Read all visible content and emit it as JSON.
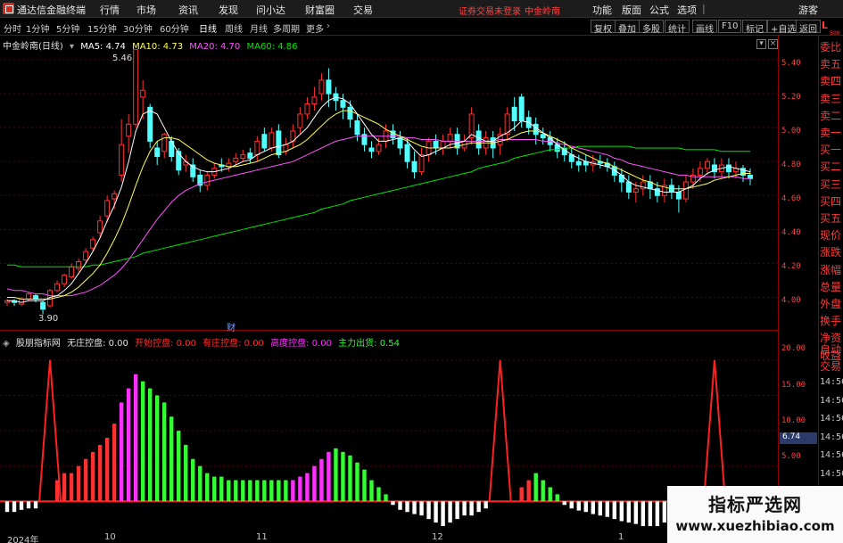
{
  "app": {
    "title": "通达信金融终端",
    "menus": [
      "行情",
      "市场",
      "资讯",
      "发现",
      "问小达",
      "财富圈",
      "交易"
    ],
    "notice": "证券交易未登录",
    "stock_name_top": "中金岭南",
    "right_menus": [
      "功能",
      "版面",
      "公式",
      "选项"
    ],
    "guest": "游客"
  },
  "toolbar": {
    "periods": [
      "分时",
      "1分钟",
      "5分钟",
      "15分钟",
      "30分钟",
      "60分钟",
      "日线",
      "周线",
      "月线",
      "多周期",
      "更多"
    ],
    "active_period": "日线",
    "right_buttons": [
      "复权",
      "叠加",
      "多股",
      "统计",
      "画线",
      "F10",
      "标记",
      "+自选",
      "返回"
    ],
    "L_label": "L",
    "L_sub": "500"
  },
  "main_legend": {
    "stock": "中金岭南(日线)",
    "ma5": "MA5: 4.74",
    "ma10": "MA10: 4.73",
    "ma20": "MA20: 4.70",
    "ma60": "MA60: 4.86"
  },
  "price_axis": [
    "5.40",
    "5.20",
    "5.00",
    "4.80",
    "4.60",
    "4.40",
    "4.20",
    "4.00"
  ],
  "annotations": {
    "high": "5.46",
    "low": "3.90",
    "cai": "财"
  },
  "sub_legend": {
    "name": "股朋指标网",
    "none": "无庄控盘: 0.00",
    "start": "开始控盘: 0.00",
    "has": "有庄控盘: 0.00",
    "high": "高度控盘: 0.00",
    "out": "主力出货: 0.54"
  },
  "sub_axis": [
    "20.00",
    "15.00",
    "10.00",
    "5.00"
  ],
  "sub_value_badge": "6.74",
  "side_panel": [
    "委比",
    "卖五",
    "卖四",
    "卖三",
    "卖二",
    "卖一",
    "买一",
    "买二",
    "买三",
    "买四",
    "买五",
    "现价",
    "涨跌",
    "涨幅",
    "总量",
    "外盘",
    "换手",
    "净资",
    "收益"
  ],
  "side_panel2": [
    "自动",
    "交易"
  ],
  "side_times": [
    "14:56",
    "14:56",
    "14:56",
    "14:56",
    "14:56",
    "14:56",
    "14:56",
    "14:56"
  ],
  "dates": [
    "2024年",
    "10",
    "11",
    "12",
    "1"
  ],
  "watermark": {
    "title": "指标严选网",
    "url": "www.xuezhibiao.com"
  },
  "colors": {
    "up": "#ff3232",
    "down": "#54ffff",
    "ma5": "#ffffff",
    "ma10": "#ffff54",
    "ma20": "#ff54ff",
    "ma60": "#00e600",
    "start_col": "#ff3030",
    "has_col": "#ff30ff",
    "high_col": "#ff30ff",
    "out_col": "#30ff30"
  },
  "chart_data": {
    "type": "candlestick",
    "ylim": [
      3.85,
      5.5
    ],
    "candles": [
      [
        3.97,
        3.98,
        3.95,
        3.99
      ],
      [
        3.98,
        3.97,
        3.95,
        3.99
      ],
      [
        3.96,
        3.99,
        3.95,
        4.0
      ],
      [
        3.99,
        4.02,
        3.98,
        4.03
      ],
      [
        4.01,
        3.99,
        3.97,
        4.02
      ],
      [
        3.97,
        3.93,
        3.9,
        3.98
      ],
      [
        3.95,
        4.04,
        3.94,
        4.05
      ],
      [
        4.04,
        4.08,
        4.03,
        4.1
      ],
      [
        4.08,
        4.13,
        4.06,
        4.14
      ],
      [
        4.12,
        4.18,
        4.11,
        4.2
      ],
      [
        4.17,
        4.21,
        4.15,
        4.23
      ],
      [
        4.22,
        4.27,
        4.2,
        4.29
      ],
      [
        4.29,
        4.34,
        4.27,
        4.36
      ],
      [
        4.38,
        4.45,
        4.35,
        4.48
      ],
      [
        4.48,
        4.57,
        4.44,
        4.6
      ],
      [
        4.58,
        4.61,
        4.52,
        4.63
      ],
      [
        4.72,
        4.9,
        4.68,
        5.05
      ],
      [
        4.95,
        5.02,
        4.85,
        5.08
      ],
      [
        5.02,
        5.46,
        5.0,
        5.46
      ],
      [
        5.18,
        5.22,
        5.05,
        5.28
      ],
      [
        5.12,
        4.92,
        4.88,
        5.14
      ],
      [
        4.88,
        4.83,
        4.78,
        4.92
      ],
      [
        4.86,
        4.96,
        4.82,
        4.97
      ],
      [
        4.92,
        4.83,
        4.8,
        4.95
      ],
      [
        4.86,
        4.75,
        4.72,
        4.88
      ],
      [
        4.78,
        4.8,
        4.74,
        4.84
      ],
      [
        4.78,
        4.71,
        4.68,
        4.82
      ],
      [
        4.72,
        4.66,
        4.62,
        4.75
      ],
      [
        4.66,
        4.72,
        4.63,
        4.74
      ],
      [
        4.72,
        4.76,
        4.7,
        4.79
      ],
      [
        4.78,
        4.77,
        4.74,
        4.82
      ],
      [
        4.77,
        4.79,
        4.74,
        4.82
      ],
      [
        4.8,
        4.82,
        4.78,
        4.85
      ],
      [
        4.82,
        4.84,
        4.8,
        4.87
      ],
      [
        4.85,
        4.82,
        4.79,
        4.88
      ],
      [
        4.84,
        4.92,
        4.8,
        4.95
      ],
      [
        4.96,
        4.88,
        4.86,
        5.0
      ],
      [
        4.88,
        4.97,
        4.86,
        5.0
      ],
      [
        4.98,
        4.84,
        4.82,
        5.02
      ],
      [
        4.86,
        4.9,
        4.84,
        4.94
      ],
      [
        4.92,
        4.98,
        4.88,
        5.02
      ],
      [
        5.0,
        5.08,
        4.96,
        5.12
      ],
      [
        5.08,
        5.14,
        5.05,
        5.18
      ],
      [
        5.14,
        5.18,
        5.1,
        5.24
      ],
      [
        5.2,
        5.28,
        5.16,
        5.32
      ],
      [
        5.28,
        5.2,
        5.12,
        5.35
      ],
      [
        5.2,
        5.16,
        5.1,
        5.24
      ],
      [
        5.16,
        5.12,
        5.05,
        5.2
      ],
      [
        5.12,
        5.05,
        5.0,
        5.16
      ],
      [
        5.04,
        4.96,
        4.92,
        5.08
      ],
      [
        4.96,
        4.9,
        4.86,
        5.0
      ],
      [
        4.88,
        4.86,
        4.82,
        4.92
      ],
      [
        4.86,
        4.9,
        4.84,
        4.94
      ],
      [
        4.92,
        4.98,
        4.88,
        5.02
      ],
      [
        4.98,
        4.94,
        4.9,
        5.02
      ],
      [
        4.94,
        4.88,
        4.84,
        4.98
      ],
      [
        4.9,
        4.8,
        4.76,
        4.94
      ],
      [
        4.8,
        4.74,
        4.7,
        4.86
      ],
      [
        4.74,
        4.84,
        4.72,
        4.88
      ],
      [
        4.84,
        4.92,
        4.8,
        4.94
      ],
      [
        4.92,
        4.88,
        4.84,
        4.96
      ],
      [
        4.88,
        4.92,
        4.84,
        4.96
      ],
      [
        4.92,
        4.96,
        4.88,
        5.0
      ],
      [
        4.96,
        4.88,
        4.84,
        5.0
      ],
      [
        4.88,
        4.92,
        4.86,
        4.96
      ],
      [
        4.94,
        5.08,
        4.9,
        5.12
      ],
      [
        4.98,
        4.88,
        4.84,
        5.02
      ],
      [
        4.88,
        4.94,
        4.84,
        4.98
      ],
      [
        4.94,
        4.88,
        4.82,
        4.98
      ],
      [
        4.9,
        4.96,
        4.84,
        5.0
      ],
      [
        4.96,
        5.08,
        4.92,
        5.12
      ],
      [
        5.12,
        5.04,
        4.98,
        5.18
      ],
      [
        5.18,
        5.04,
        5.0,
        5.2
      ],
      [
        5.06,
        5.0,
        4.96,
        5.1
      ],
      [
        5.02,
        4.96,
        4.9,
        5.06
      ],
      [
        4.96,
        4.94,
        4.9,
        5.0
      ],
      [
        4.94,
        4.9,
        4.86,
        4.98
      ],
      [
        4.9,
        4.86,
        4.82,
        4.94
      ],
      [
        4.88,
        4.84,
        4.8,
        4.92
      ],
      [
        4.84,
        4.8,
        4.76,
        4.88
      ],
      [
        4.8,
        4.78,
        4.74,
        4.84
      ],
      [
        4.8,
        4.78,
        4.74,
        4.84
      ],
      [
        4.78,
        4.8,
        4.74,
        4.84
      ],
      [
        4.8,
        4.79,
        4.76,
        4.84
      ],
      [
        4.79,
        4.77,
        4.74,
        4.82
      ],
      [
        4.77,
        4.72,
        4.68,
        4.8
      ],
      [
        4.72,
        4.68,
        4.62,
        4.76
      ],
      [
        4.68,
        4.62,
        4.58,
        4.72
      ],
      [
        4.62,
        4.64,
        4.56,
        4.68
      ],
      [
        4.64,
        4.68,
        4.6,
        4.72
      ],
      [
        4.68,
        4.64,
        4.58,
        4.72
      ],
      [
        4.64,
        4.6,
        4.56,
        4.68
      ],
      [
        4.6,
        4.66,
        4.56,
        4.7
      ],
      [
        4.66,
        4.62,
        4.58,
        4.7
      ],
      [
        4.62,
        4.58,
        4.5,
        4.66
      ],
      [
        4.58,
        4.68,
        4.56,
        4.72
      ],
      [
        4.68,
        4.72,
        4.64,
        4.76
      ],
      [
        4.72,
        4.76,
        4.68,
        4.8
      ],
      [
        4.76,
        4.8,
        4.72,
        4.82
      ],
      [
        4.78,
        4.74,
        4.7,
        4.82
      ],
      [
        4.74,
        4.78,
        4.7,
        4.82
      ],
      [
        4.78,
        4.74,
        4.7,
        4.82
      ],
      [
        4.74,
        4.76,
        4.7,
        4.8
      ],
      [
        4.76,
        4.72,
        4.68,
        4.78
      ],
      [
        4.72,
        4.7,
        4.66,
        4.76
      ]
    ],
    "ma5": [
      3.98,
      3.98,
      3.97,
      3.98,
      3.98,
      3.98,
      4.0,
      4.01,
      4.04,
      4.08,
      4.14,
      4.2,
      4.27,
      4.35,
      4.45,
      4.54,
      4.65,
      4.8,
      4.98,
      5.08,
      5.1,
      5.08,
      5.0,
      4.92,
      4.85,
      4.8,
      4.77,
      4.75,
      4.74,
      4.74,
      4.75,
      4.76,
      4.78,
      4.8,
      4.81,
      4.84,
      4.86,
      4.88,
      4.89,
      4.9,
      4.92,
      4.96,
      5.0,
      5.06,
      5.12,
      5.16,
      5.18,
      5.17,
      5.14,
      5.08,
      5.02,
      4.96,
      4.92,
      4.92,
      4.93,
      4.94,
      4.92,
      4.87,
      4.83,
      4.84,
      4.86,
      4.88,
      4.9,
      4.91,
      4.92,
      4.96,
      4.94,
      4.92,
      4.92,
      4.95,
      4.97,
      5.0,
      5.04,
      5.03,
      5.0,
      4.97,
      4.94,
      4.9,
      4.87,
      4.84,
      4.82,
      4.8,
      4.79,
      4.78,
      4.77,
      4.75,
      4.72,
      4.68,
      4.66,
      4.65,
      4.64,
      4.63,
      4.62,
      4.62,
      4.62,
      4.64,
      4.66,
      4.7,
      4.73,
      4.75,
      4.76,
      4.77,
      4.76,
      4.75,
      4.74
    ],
    "ma10": [
      4.0,
      4.0,
      3.99,
      3.99,
      3.99,
      3.99,
      3.99,
      4.0,
      4.01,
      4.03,
      4.06,
      4.1,
      4.14,
      4.19,
      4.26,
      4.34,
      4.43,
      4.54,
      4.66,
      4.77,
      4.86,
      4.92,
      4.94,
      4.94,
      4.93,
      4.9,
      4.87,
      4.84,
      4.81,
      4.79,
      4.78,
      4.77,
      4.77,
      4.78,
      4.79,
      4.8,
      4.82,
      4.84,
      4.85,
      4.86,
      4.88,
      4.9,
      4.93,
      4.97,
      5.01,
      5.05,
      5.08,
      5.1,
      5.1,
      5.08,
      5.06,
      5.04,
      5.02,
      4.99,
      4.97,
      4.95,
      4.93,
      4.91,
      4.89,
      4.88,
      4.88,
      4.88,
      4.88,
      4.89,
      4.9,
      4.91,
      4.91,
      4.91,
      4.91,
      4.92,
      4.93,
      4.95,
      4.97,
      4.98,
      4.98,
      4.97,
      4.95,
      4.93,
      4.91,
      4.88,
      4.86,
      4.84,
      4.82,
      4.8,
      4.79,
      4.77,
      4.75,
      4.73,
      4.71,
      4.69,
      4.68,
      4.66,
      4.65,
      4.64,
      4.64,
      4.64,
      4.65,
      4.66,
      4.67,
      4.69,
      4.7,
      4.71,
      4.72,
      4.73,
      4.73
    ],
    "ma20": [
      4.05,
      4.04,
      4.04,
      4.03,
      4.02,
      4.02,
      4.01,
      4.01,
      4.01,
      4.01,
      4.02,
      4.03,
      4.05,
      4.07,
      4.1,
      4.13,
      4.17,
      4.22,
      4.28,
      4.34,
      4.4,
      4.46,
      4.51,
      4.56,
      4.6,
      4.63,
      4.65,
      4.67,
      4.68,
      4.69,
      4.7,
      4.71,
      4.72,
      4.73,
      4.74,
      4.75,
      4.76,
      4.77,
      4.78,
      4.79,
      4.8,
      4.82,
      4.84,
      4.86,
      4.88,
      4.9,
      4.92,
      4.93,
      4.94,
      4.95,
      4.95,
      4.95,
      4.95,
      4.95,
      4.95,
      4.95,
      4.94,
      4.94,
      4.93,
      4.93,
      4.93,
      4.92,
      4.92,
      4.92,
      4.92,
      4.92,
      4.92,
      4.92,
      4.92,
      4.93,
      4.93,
      4.93,
      4.93,
      4.93,
      4.93,
      4.92,
      4.92,
      4.91,
      4.9,
      4.89,
      4.88,
      4.87,
      4.86,
      4.85,
      4.84,
      4.82,
      4.81,
      4.79,
      4.78,
      4.77,
      4.76,
      4.75,
      4.74,
      4.73,
      4.72,
      4.72,
      4.71,
      4.71,
      4.71,
      4.71,
      4.71,
      4.71,
      4.71,
      4.7,
      4.7
    ],
    "ma60": [
      4.19,
      4.19,
      4.18,
      4.18,
      4.18,
      4.18,
      4.18,
      4.18,
      4.18,
      4.18,
      4.18,
      4.18,
      4.19,
      4.19,
      4.2,
      4.21,
      4.22,
      4.23,
      4.24,
      4.26,
      4.27,
      4.28,
      4.29,
      4.3,
      4.31,
      4.32,
      4.33,
      4.34,
      4.35,
      4.36,
      4.37,
      4.38,
      4.39,
      4.4,
      4.41,
      4.42,
      4.43,
      4.44,
      4.45,
      4.46,
      4.47,
      4.48,
      4.49,
      4.5,
      4.52,
      4.53,
      4.54,
      4.55,
      4.57,
      4.58,
      4.59,
      4.6,
      4.61,
      4.62,
      4.63,
      4.64,
      4.65,
      4.66,
      4.67,
      4.68,
      4.69,
      4.7,
      4.71,
      4.72,
      4.73,
      4.74,
      4.76,
      4.77,
      4.78,
      4.79,
      4.8,
      4.82,
      4.83,
      4.84,
      4.85,
      4.86,
      4.87,
      4.87,
      4.88,
      4.88,
      4.89,
      4.89,
      4.89,
      4.89,
      4.89,
      4.89,
      4.89,
      4.89,
      4.88,
      4.88,
      4.88,
      4.88,
      4.88,
      4.88,
      4.88,
      4.87,
      4.87,
      4.87,
      4.87,
      4.87,
      4.86,
      4.86,
      4.86,
      4.86,
      4.86
    ],
    "sub_ylim": [
      -4,
      22
    ],
    "sub_bars": [
      -1.5,
      -1.5,
      -1.2,
      -1.0,
      -1.0,
      0,
      20,
      3,
      4,
      4,
      5,
      6,
      7,
      8,
      9,
      11,
      14,
      16,
      18,
      17,
      16,
      15,
      14,
      12,
      10,
      8,
      6,
      5,
      4,
      3.5,
      3.5,
      3,
      3,
      3,
      3,
      3,
      3,
      3,
      3,
      3,
      3,
      3.5,
      4,
      5,
      6,
      7,
      7.5,
      7,
      6.5,
      5.5,
      4.5,
      3,
      2,
      1,
      -0.5,
      -1.2,
      -1.5,
      -1.8,
      -2.0,
      -2.5,
      -3.0,
      -3.5,
      -3.0,
      -2.5,
      -2.0,
      -2.0,
      -1.5,
      -1,
      0,
      20,
      0,
      0,
      2,
      3,
      4,
      3,
      2,
      1,
      -0.5,
      -1.0,
      -1.3,
      -1.5,
      -1.8,
      -2.0,
      -2.2,
      -2.5,
      -2.8,
      -3.0,
      -3.2,
      -3.5,
      -3.5,
      -3.5,
      -3.0,
      -2.6,
      -2.5,
      -2.5,
      -2.2,
      -2.0,
      -1.8,
      20,
      -1.5,
      -1.2,
      -1.0,
      -1.0,
      -0.8
    ],
    "sub_bar_colors": [
      "w",
      "w",
      "w",
      "w",
      "w",
      "r",
      "peak",
      "r",
      "r",
      "r",
      "r",
      "r",
      "r",
      "r",
      "r",
      "r",
      "m",
      "m",
      "m",
      "g",
      "g",
      "g",
      "g",
      "g",
      "g",
      "g",
      "g",
      "g",
      "g",
      "g",
      "g",
      "g",
      "g",
      "g",
      "g",
      "g",
      "g",
      "g",
      "g",
      "g",
      "m",
      "m",
      "m",
      "m",
      "m",
      "m",
      "g",
      "g",
      "g",
      "g",
      "g",
      "g",
      "g",
      "g",
      "w",
      "w",
      "w",
      "w",
      "w",
      "w",
      "w",
      "w",
      "w",
      "w",
      "w",
      "w",
      "w",
      "w",
      "r",
      "peak",
      "r",
      "r",
      "r",
      "r",
      "g",
      "g",
      "g",
      "g",
      "w",
      "w",
      "w",
      "w",
      "w",
      "w",
      "w",
      "w",
      "w",
      "w",
      "w",
      "w",
      "w",
      "w",
      "w",
      "w",
      "w",
      "w",
      "w",
      "w",
      "w",
      "peak",
      "w",
      "w",
      "w",
      "w",
      "w"
    ]
  }
}
